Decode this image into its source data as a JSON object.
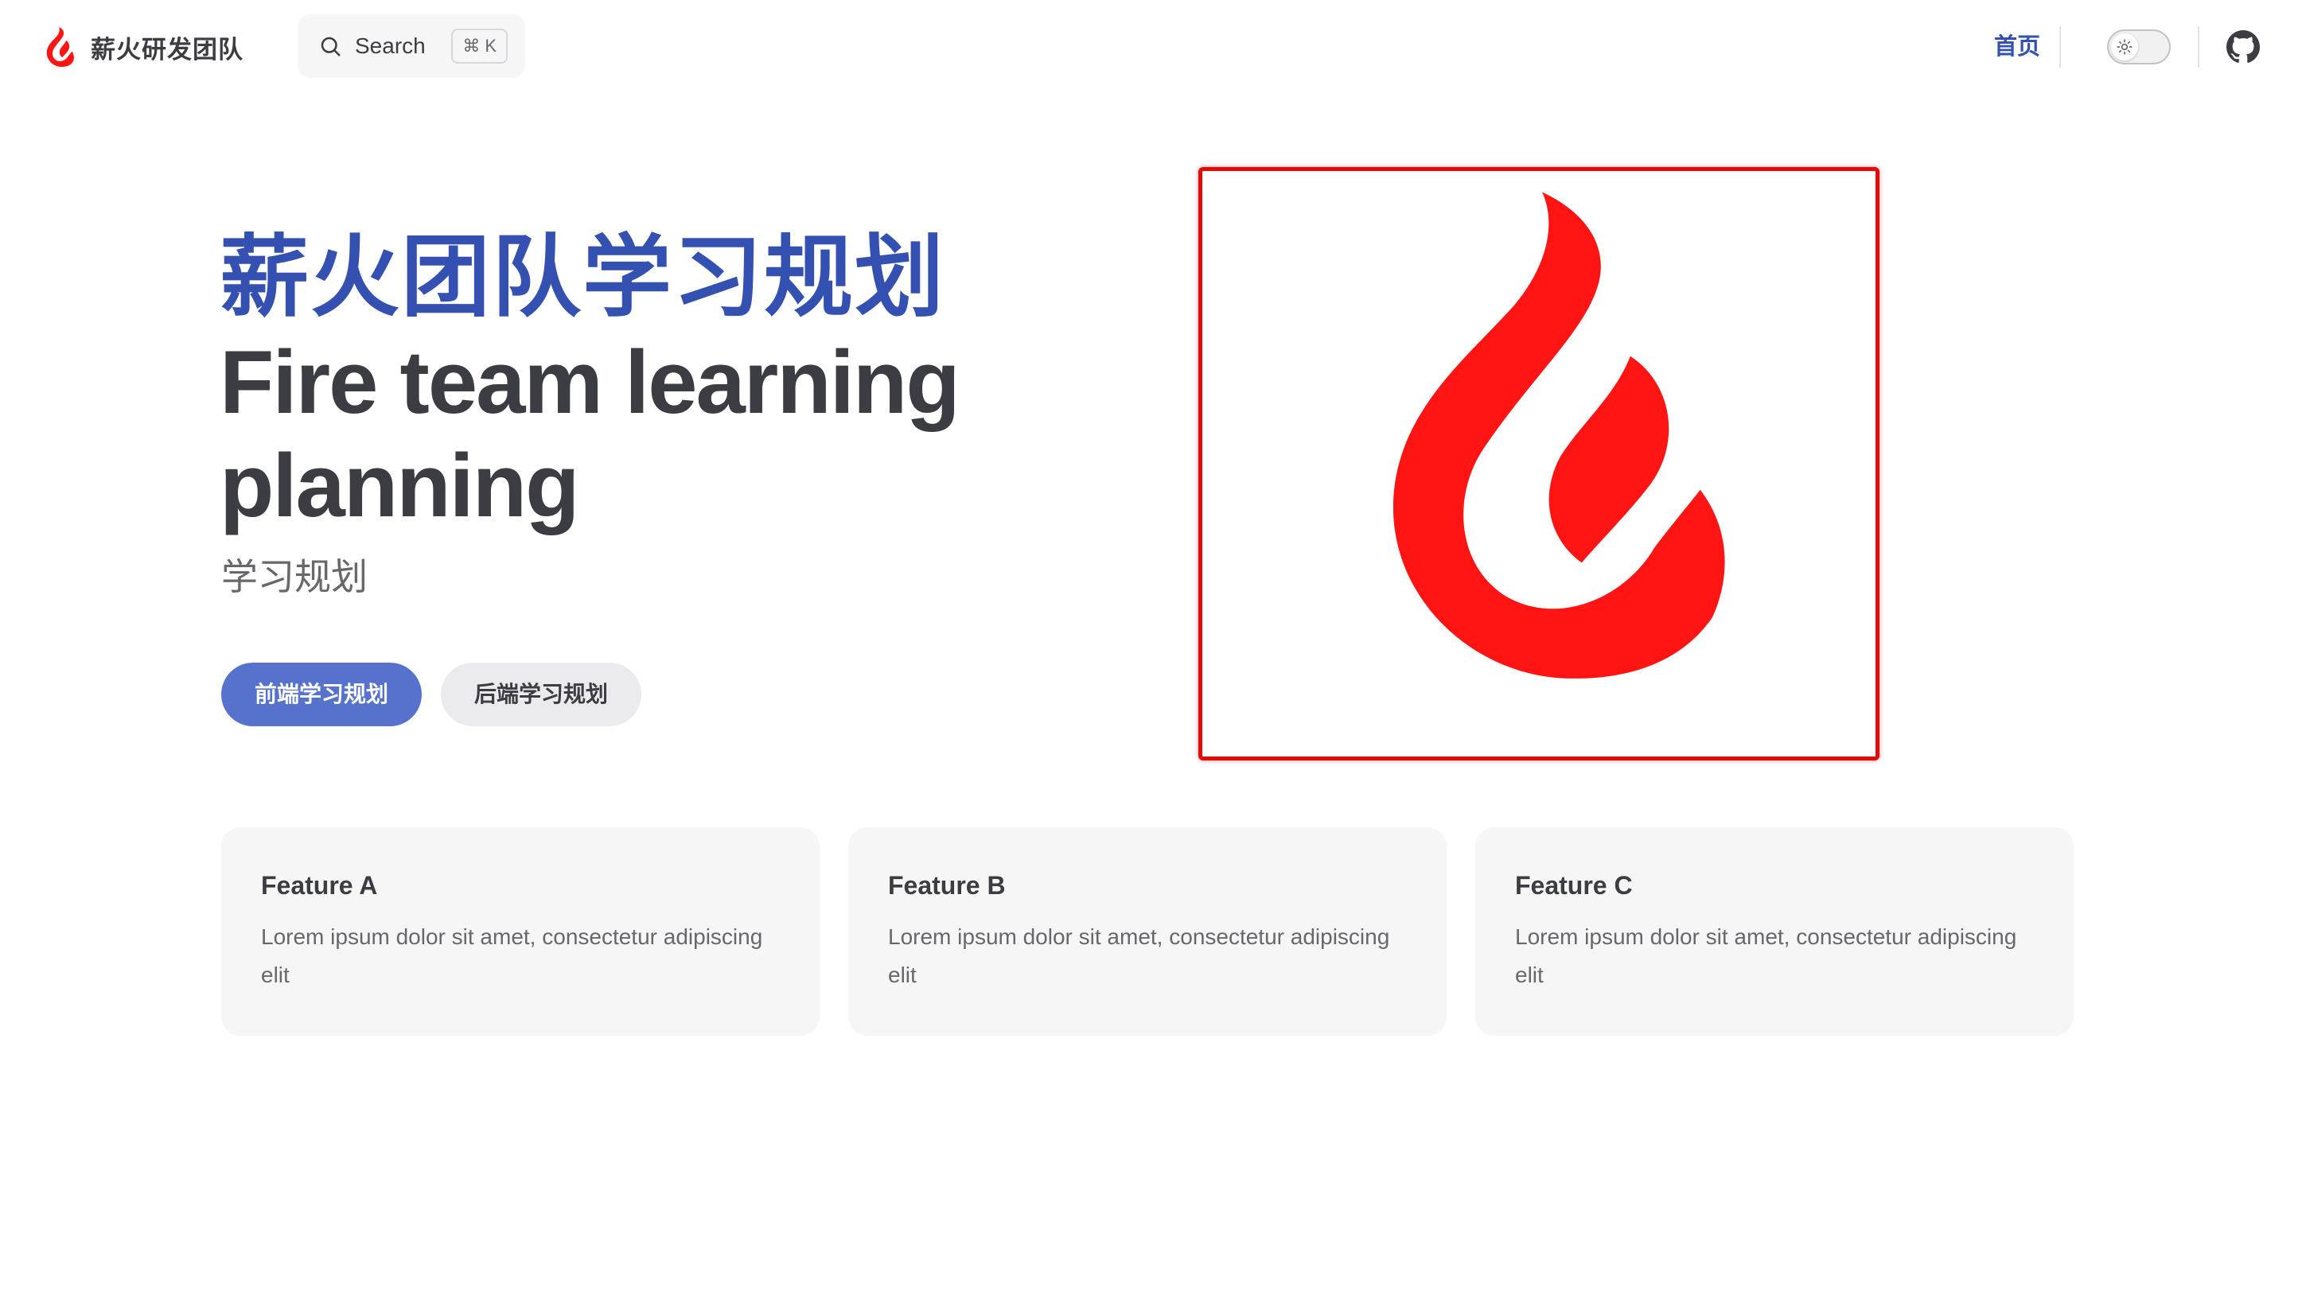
{
  "nav": {
    "site_title": "薪火研发团队",
    "search": {
      "label": "Search",
      "shortcut_symbol": "⌘",
      "shortcut_key": "K"
    },
    "links": [
      {
        "label": "首页"
      }
    ],
    "appearance_toggle_icon": "sun-icon",
    "social_icon": "github-icon"
  },
  "hero": {
    "name": "薪火团队学习规划",
    "text": "Fire team learning planning",
    "tagline": "学习规划",
    "actions": [
      {
        "label": "前端学习规划",
        "theme": "brand"
      },
      {
        "label": "后端学习规划",
        "theme": "alt"
      }
    ],
    "image_icon": "flame-logo-icon"
  },
  "features": [
    {
      "title": "Feature A",
      "details": "Lorem ipsum dolor sit amet, consectetur adipiscing elit"
    },
    {
      "title": "Feature B",
      "details": "Lorem ipsum dolor sit amet, consectetur adipiscing elit"
    },
    {
      "title": "Feature C",
      "details": "Lorem ipsum dolor sit amet, consectetur adipiscing elit"
    }
  ],
  "colors": {
    "brand": "#3451b2",
    "brand_button": "#5672cd",
    "logo_red": "#ff1414",
    "highlight_border": "#e30a0a",
    "text": "#3c3c43",
    "text_muted": "#67676c",
    "soft_bg": "#f6f6f7"
  }
}
